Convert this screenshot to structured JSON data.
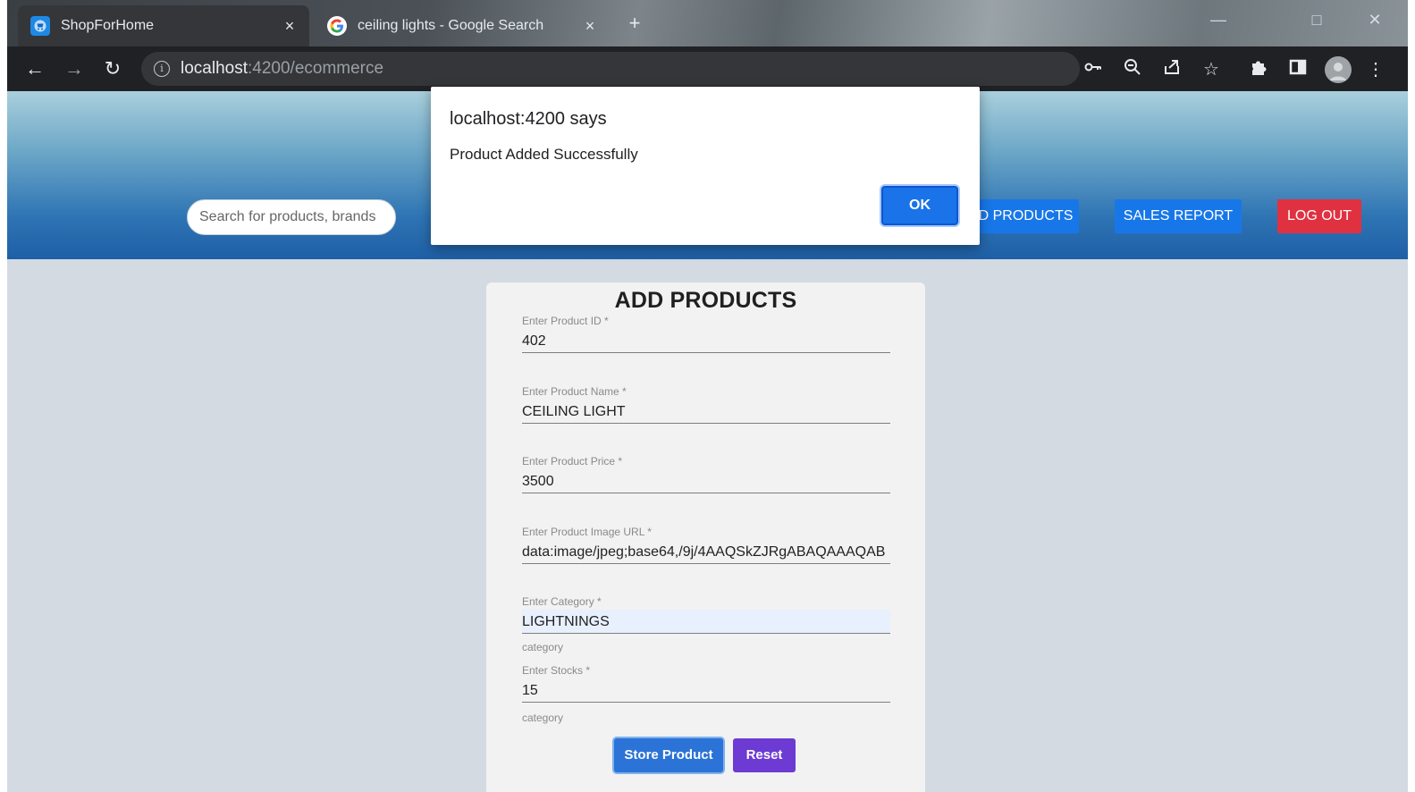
{
  "browser": {
    "tabs": [
      {
        "title": "ShopForHome",
        "close": "×"
      },
      {
        "title": "ceiling lights - Google Search",
        "close": "×"
      }
    ],
    "new_tab": "+",
    "address": {
      "host": "localhost",
      "rest": ":4200/ecommerce"
    },
    "icons": [
      "back-icon",
      "forward-icon",
      "reload-icon",
      "info-icon",
      "key-icon",
      "zoom-icon",
      "share-icon",
      "star-icon",
      "extensions-icon",
      "side-panel-icon",
      "profile-avatar",
      "menu-icon"
    ]
  },
  "header": {
    "search_placeholder": "Search for products, brands",
    "nav": {
      "products": "D PRODUCTS",
      "sales_report": "SALES REPORT",
      "logout": "LOG OUT"
    }
  },
  "form": {
    "title": "ADD PRODUCTS",
    "fields": [
      {
        "label": "Enter Product ID *",
        "value": "402"
      },
      {
        "label": "Enter Product Name *",
        "value": "CEILING LIGHT"
      },
      {
        "label": "Enter Product Price *",
        "value": "3500"
      },
      {
        "label": "Enter Product Image URL *",
        "value": "data:image/jpeg;base64,/9j/4AAQSkZJRgABAQAAAQAB"
      },
      {
        "label": "Enter Category *",
        "value": "LIGHTNINGS"
      },
      {
        "label": "Enter Stocks *",
        "value": "15"
      }
    ],
    "hint_category_1": "category",
    "hint_category_2": "category",
    "store_label": "Store Product",
    "reset_label": "Reset"
  },
  "dialog": {
    "title": "localhost:4200 says",
    "message": "Product Added Successfully",
    "ok_label": "OK"
  },
  "colors": {
    "primary_button": "#1877e8",
    "logout_button": "#e03141",
    "reset_button": "#6d3ad3",
    "dialog_ok": "#1a73e8"
  }
}
